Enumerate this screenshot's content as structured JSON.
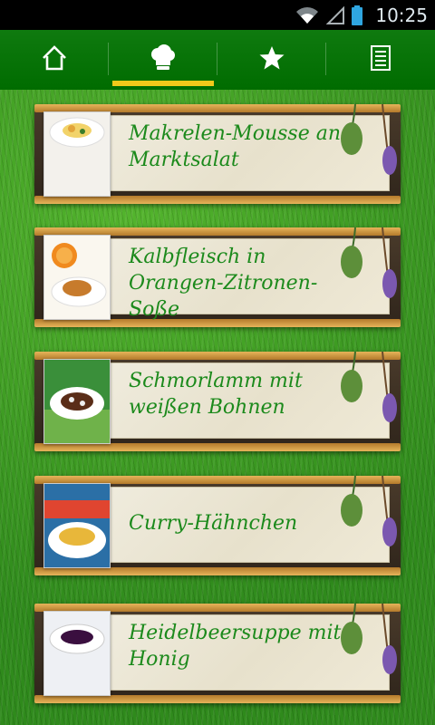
{
  "status_bar": {
    "time": "10:25"
  },
  "nav": {
    "items": [
      {
        "name": "home",
        "icon": "home-icon"
      },
      {
        "name": "recipes",
        "icon": "chef-hat-icon",
        "active": true
      },
      {
        "name": "favorites",
        "icon": "star-icon"
      },
      {
        "name": "list",
        "icon": "list-icon"
      }
    ]
  },
  "recipes": [
    {
      "title": "Makrelen-Mousse an Marktsalat"
    },
    {
      "title": "Kalbfleisch in Orangen-Zitronen-Soße"
    },
    {
      "title": "Schmorlamm mit weißen Bohnen"
    },
    {
      "title": "Curry-Hähnchen"
    },
    {
      "title": "Heidelbeersuppe mit Honig"
    }
  ],
  "colors": {
    "nav_bg": "#0a730a",
    "active_indicator": "#f1c91a",
    "title_text": "#1c8a1c"
  }
}
